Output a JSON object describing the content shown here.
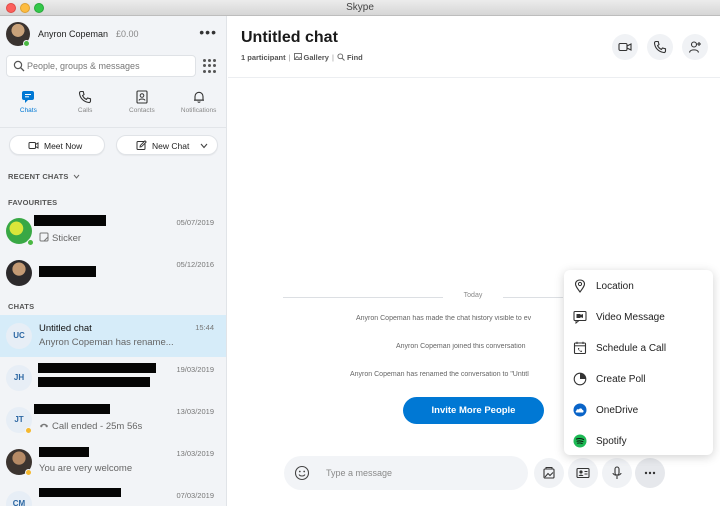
{
  "window": {
    "title": "Skype"
  },
  "profile": {
    "name": "Anyron Copeman",
    "credit": "£0.00"
  },
  "search": {
    "placeholder": "People, groups & messages"
  },
  "nav": [
    {
      "label": "Chats"
    },
    {
      "label": "Calls"
    },
    {
      "label": "Contacts"
    },
    {
      "label": "Notifications"
    }
  ],
  "actions": {
    "meet_now": "Meet Now",
    "new_chat": "New Chat"
  },
  "sections": {
    "recent": "RECENT CHATS",
    "favourites": "FAVOURITES",
    "chats": "CHATS"
  },
  "favourites": [
    {
      "name": "",
      "sub": "Sticker",
      "date": "05/07/2019",
      "initials": ""
    },
    {
      "name": "",
      "sub": "",
      "date": "05/12/2016",
      "initials": ""
    }
  ],
  "chats": [
    {
      "initials": "UC",
      "name": "Untitled chat",
      "sub": "Anyron Copeman has rename...",
      "date": "15:44"
    },
    {
      "initials": "JH",
      "name": "",
      "sub": "",
      "date": "19/03/2019"
    },
    {
      "initials": "JT",
      "name": "",
      "sub": "Call ended - 25m 56s",
      "date": "13/03/2019"
    },
    {
      "initials": "",
      "name": "",
      "sub": "You are very welcome",
      "date": "13/03/2019"
    },
    {
      "initials": "CM",
      "name": "",
      "sub": "",
      "date": "07/03/2019"
    }
  ],
  "chat": {
    "title": "Untitled chat",
    "participants": "1 participant",
    "gallery": "Gallery",
    "find": "Find",
    "date_divider": "Today",
    "system_messages": [
      "Anyron Copeman has made the chat history visible to ev",
      "Anyron Copeman joined this conversation",
      "Anyron Copeman has renamed the conversation to \"Untitl"
    ],
    "invite_button": "Invite More People"
  },
  "composer": {
    "placeholder": "Type a message"
  },
  "menu": [
    {
      "label": "Location",
      "icon": "location-pin-icon"
    },
    {
      "label": "Video Message",
      "icon": "video-message-icon"
    },
    {
      "label": "Schedule a Call",
      "icon": "schedule-call-icon"
    },
    {
      "label": "Create Poll",
      "icon": "poll-icon"
    },
    {
      "label": "OneDrive",
      "icon": "onedrive-icon"
    },
    {
      "label": "Spotify",
      "icon": "spotify-icon"
    }
  ],
  "colors": {
    "accent": "#0078d4",
    "selected_row": "#d6ecf9",
    "sidebar_bg": "#f2f4f7",
    "online": "#4ab842",
    "away": "#f5b82e"
  }
}
